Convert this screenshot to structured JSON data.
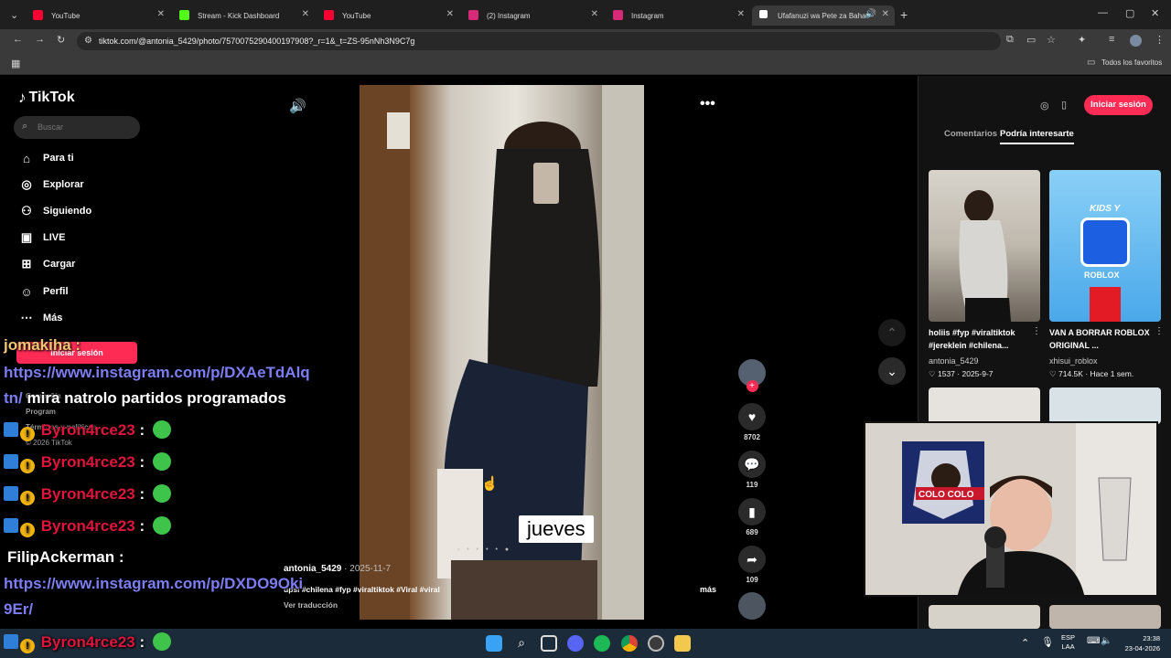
{
  "browser": {
    "tabs": [
      {
        "title": "YouTube",
        "color": "#ff0033"
      },
      {
        "title": "Stream - Kick Dashboard",
        "color": "#53fc18"
      },
      {
        "title": "YouTube",
        "color": "#ff0033"
      },
      {
        "title": "(2) Instagram",
        "color": "#d62976"
      },
      {
        "title": "Instagram",
        "color": "#d62976"
      },
      {
        "title": "Ufafanuzi wa Pete za Bahati",
        "color": "#ffffff"
      }
    ],
    "url": "tiktok.com/@antonia_5429/photo/7570075290400197908?_r=1&_t=ZS-95nNh3N9C7g",
    "bookmarks_label": "Todos los favoritos"
  },
  "tiktok": {
    "logo": "TikTok",
    "search_placeholder": "Buscar",
    "nav": [
      {
        "label": "Para ti",
        "icon": "home-icon",
        "glyph": "⌂"
      },
      {
        "label": "Explorar",
        "icon": "compass-icon",
        "glyph": "◎"
      },
      {
        "label": "Siguiendo",
        "icon": "person-follow-icon",
        "glyph": "⚇"
      },
      {
        "label": "LIVE",
        "icon": "live-tv-icon",
        "glyph": "▣"
      },
      {
        "label": "Cargar",
        "icon": "upload-plus-icon",
        "glyph": "⊞"
      },
      {
        "label": "Perfil",
        "icon": "profile-icon",
        "glyph": "☺"
      },
      {
        "label": "Más",
        "icon": "more-dots-icon",
        "glyph": "⋯"
      }
    ],
    "login_button": "Iniciar sesión",
    "footer_company": "Compañía",
    "footer_program": "Program",
    "footer_terms": "Términos y políticas",
    "copyright": "© 2026 TikTok",
    "post": {
      "author": "antonia_5429",
      "date": "2025-11-7",
      "caption": "upsi #chilena #fyp #viraltiktok #Viral #viral",
      "more": "más",
      "translate": "Ver traducción",
      "overlay_word": "jueves",
      "likes": "8702",
      "comments": "119",
      "saves": "689",
      "shares": "109"
    },
    "right_panel": {
      "login_button": "Iniciar sesión",
      "tab_comments": "Comentarios",
      "tab_suggested": "Podría interesarte",
      "cards": [
        {
          "desc": "holiis #fyp #viraltiktok #jereklein #chilena...",
          "author": "antonia_5429",
          "likes": "1537",
          "date": "2025-9-7"
        },
        {
          "desc": "VAN A BORRAR ROBLOX ORIGINAL ...",
          "author": "xhisui_roblox",
          "likes": "714.5K",
          "date": "Hace 1 sem."
        }
      ],
      "thumb2_caption": "KIDS Y",
      "thumb2_brand": "ROBLOX"
    }
  },
  "stream_overlay": {
    "chat": [
      {
        "user": "jomakiha",
        "suffix": " :",
        "type": "plain"
      },
      {
        "text": "https://www.instagram.com/p/DXAeTdAlq",
        "type": "link"
      },
      {
        "text_link": "tn/",
        "text": " mira natrolo partidos programados",
        "type": "mixed"
      },
      {
        "user": "Byron4rce23",
        "suffix": " :",
        "type": "badged"
      },
      {
        "user": "Byron4rce23",
        "suffix": " :",
        "type": "badged"
      },
      {
        "user": "Byron4rce23",
        "suffix": " :",
        "type": "badged"
      },
      {
        "user": "Byron4rce23",
        "suffix": " :",
        "type": "badged"
      },
      {
        "user": "FilipAckerman",
        "suffix": " :",
        "type": "plain"
      },
      {
        "text": "https://www.instagram.com/p/DXDO9Oki",
        "type": "link"
      },
      {
        "text": "9Er/",
        "type": "link"
      },
      {
        "user": "Byron4rce23",
        "suffix": " :",
        "type": "badged"
      }
    ],
    "webcam_flag_text": "COLO COLO"
  },
  "taskbar": {
    "lang": "ESP",
    "region": "LAA",
    "time": "23:38",
    "date": "23-04-2026"
  }
}
